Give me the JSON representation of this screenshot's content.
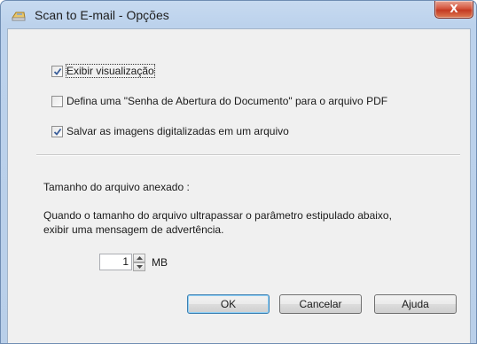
{
  "window": {
    "title": "Scan to E-mail - Opções",
    "close_glyph": "X"
  },
  "options": [
    {
      "label": "Exibir visualização",
      "checked": true
    },
    {
      "label": "Defina uma \"Senha de Abertura do Documento\" para o arquivo PDF",
      "checked": false
    },
    {
      "label": "Salvar as imagens digitalizadas em um arquivo",
      "checked": true
    }
  ],
  "attachment": {
    "heading": "Tamanho do arquivo anexado :",
    "description_line1": "Quando o tamanho do arquivo ultrapassar o parâmetro estipulado abaixo,",
    "description_line2": "exibir uma mensagem de advertência.",
    "size_value": "1",
    "unit": "MB"
  },
  "buttons": {
    "ok": "OK",
    "cancel": "Cancelar",
    "help": "Ajuda"
  },
  "icons": {
    "title": "scanner-email-icon",
    "check": "checkmark-icon",
    "spin_up": "arrow-up-icon",
    "spin_down": "arrow-down-icon"
  },
  "colors": {
    "title_gradient_top": "#c7daf0",
    "close_red": "#c43a22",
    "check_blue": "#3a5e9a",
    "default_button_border": "#3c7fb1"
  }
}
